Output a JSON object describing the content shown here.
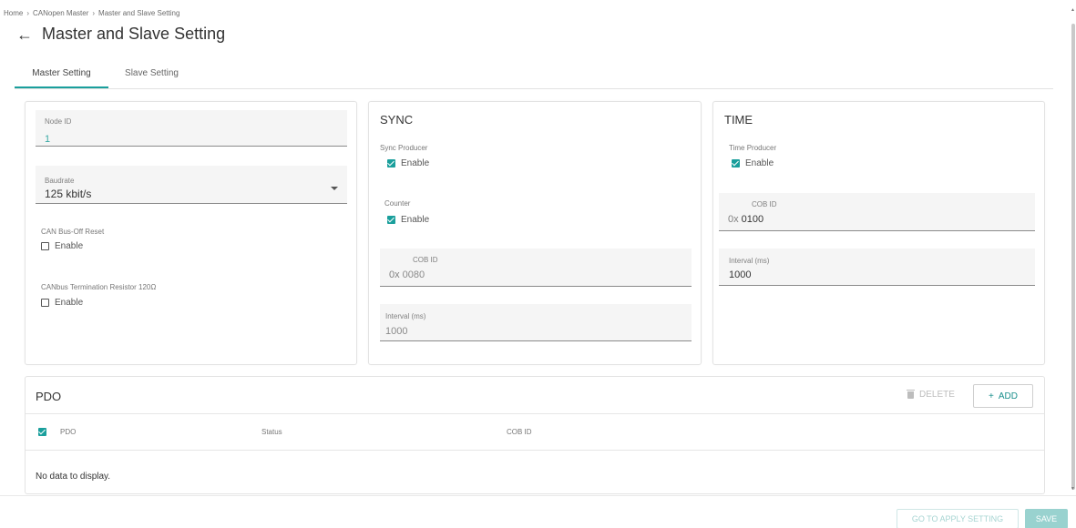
{
  "breadcrumb": {
    "home": "Home",
    "parent": "CANopen Master",
    "current": "Master and Slave Setting",
    "separator": "›"
  },
  "header": {
    "title": "Master and Slave Setting",
    "back_icon": "←"
  },
  "tabs": [
    {
      "label": "Master Setting",
      "active": true
    },
    {
      "label": "Slave Setting",
      "active": false
    }
  ],
  "master": {
    "node_id": {
      "label": "Node ID",
      "value": "1"
    },
    "baudrate": {
      "label": "Baudrate",
      "value": "125 kbit/s"
    },
    "bus_off_reset": {
      "label": "CAN Bus-Off Reset",
      "option": "Enable",
      "checked": false
    },
    "termination": {
      "label": "CANbus Termination Resistor 120Ω",
      "option": "Enable",
      "checked": false
    }
  },
  "sync": {
    "title": "SYNC",
    "producer": {
      "label": "Sync Producer",
      "option": "Enable",
      "checked": true
    },
    "counter": {
      "label": "Counter",
      "option": "Enable",
      "checked": true
    },
    "cob_id": {
      "label": "COB ID",
      "prefix": "0x",
      "value": "0080"
    },
    "interval": {
      "label": "Interval (ms)",
      "value": "1000"
    }
  },
  "time": {
    "title": "TIME",
    "producer": {
      "label": "Time Producer",
      "option": "Enable",
      "checked": true
    },
    "cob_id": {
      "label": "COB ID",
      "prefix": "0x",
      "value": "0100"
    },
    "interval": {
      "label": "Interval (ms)",
      "value": "1000"
    }
  },
  "pdo": {
    "title": "PDO",
    "delete_label": "DELETE",
    "add_label": "ADD",
    "add_icon": "+",
    "columns": [
      "PDO",
      "Status",
      "COB ID"
    ],
    "empty_text": "No data to display."
  },
  "footer": {
    "apply_label": "GO TO APPLY SETTING",
    "save_label": "SAVE"
  },
  "colors": {
    "accent": "#1a9f9c"
  }
}
